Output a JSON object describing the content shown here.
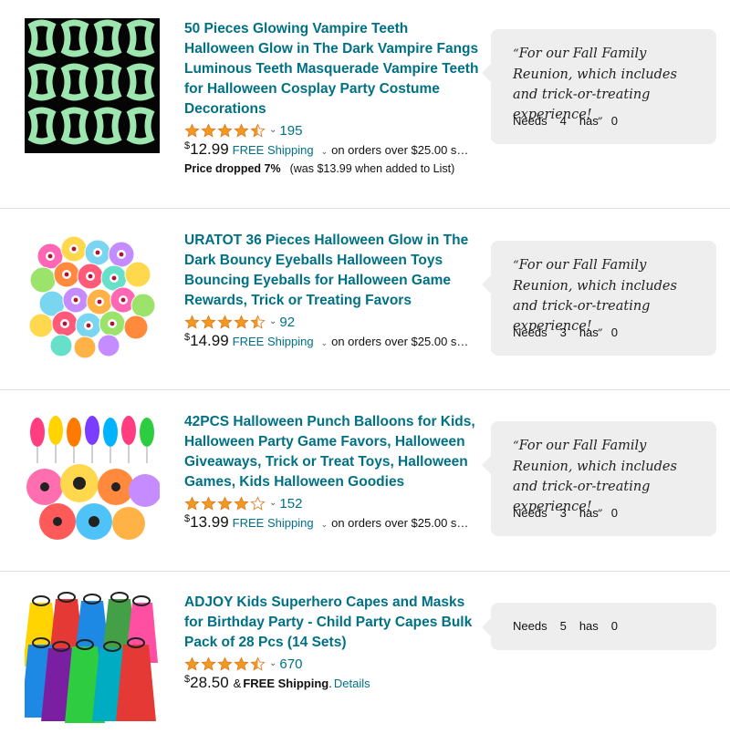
{
  "items": [
    {
      "title": "50 Pieces Glowing Vampire Teeth Halloween Glow in The Dark Vampire Fangs Luminous Teeth Masquerade Vampire Teeth for Halloween Cosplay Party Costume Decorations",
      "rating": 4.5,
      "ratings_count": "195",
      "price_symbol": "$",
      "price": "12.99",
      "shipping": "FREE Shipping",
      "order_note": "on orders over $25.00 s…",
      "price_drop_label": "Price dropped 7%",
      "price_drop_note": "(was $13.99 when added to List)",
      "comment": "For our Fall Family Reunion, which includes and trick-or-treating experience!",
      "needs_label": "Needs",
      "needs": "4",
      "has_label": "has",
      "has": "0",
      "image_icon": "glowing-vampire-teeth-image"
    },
    {
      "title": "URATOT 36 Pieces Halloween Glow in The Dark Bouncy Eyeballs Halloween Toys Bouncing Eyeballs for Halloween Game Rewards, Trick or Treating Favors",
      "rating": 4.5,
      "ratings_count": "92",
      "price_symbol": "$",
      "price": "14.99",
      "shipping": "FREE Shipping",
      "order_note": "on orders over $25.00 s…",
      "comment": "For our Fall Family Reunion, which includes and trick-or-treating experience!",
      "needs_label": "Needs",
      "needs": "3",
      "has_label": "has",
      "has": "0",
      "image_icon": "bouncy-eyeballs-image"
    },
    {
      "title": "42PCS Halloween Punch Balloons for Kids, Halloween Party Game Favors, Halloween Giveaways, Trick or Treat Toys, Halloween Games, Kids Halloween Goodies",
      "rating": 4,
      "ratings_count": "152",
      "price_symbol": "$",
      "price": "13.99",
      "shipping": "FREE Shipping",
      "order_note": "on orders over $25.00 s…",
      "comment": "For our Fall Family Reunion, which includes and trick-or-treating experience!",
      "needs_label": "Needs",
      "needs": "3",
      "has_label": "has",
      "has": "0",
      "image_icon": "punch-balloons-image"
    },
    {
      "title": "ADJOY Kids Superhero Capes and Masks for Birthday Party - Child Party Capes Bulk Pack of 28 Pcs (14 Sets)",
      "rating": 4.5,
      "ratings_count": "670",
      "price_symbol": "$",
      "price": "28.50",
      "amp": "&",
      "shipping_bold": "FREE Shipping",
      "shipping_period": ".",
      "details_link": "Details",
      "needs_label": "Needs",
      "needs": "5",
      "has_label": "has",
      "has": "0",
      "image_icon": "superhero-capes-image"
    }
  ],
  "colors": {
    "link": "#007185",
    "star": "#f29a1f",
    "bubble": "#eeeeee",
    "divider": "#dddddd"
  }
}
